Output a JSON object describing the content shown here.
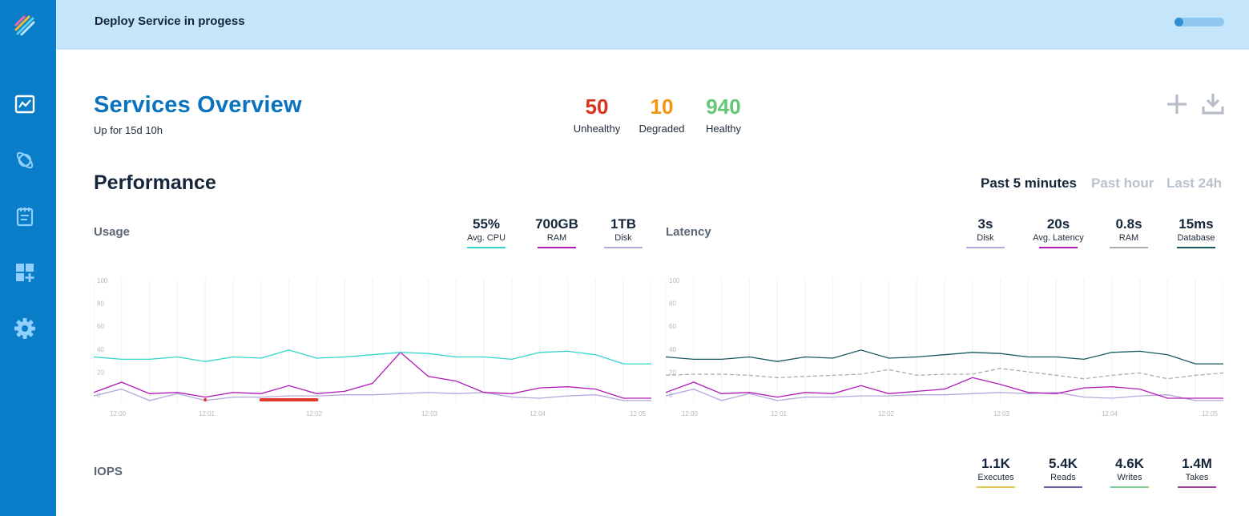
{
  "topbar": {
    "title": "Deploy Service in progess",
    "progress_pct": 0
  },
  "header": {
    "title": "Services Overview",
    "uptime": "Up for 15d 10h"
  },
  "summary": [
    {
      "value": "50",
      "label": "Unhealthy",
      "color": "#d9321f"
    },
    {
      "value": "10",
      "label": "Degraded",
      "color": "#f5950f"
    },
    {
      "value": "940",
      "label": "Healthy",
      "color": "#63c774"
    }
  ],
  "sidebar": {
    "icons": [
      "logo-icon",
      "chart-icon",
      "planet-icon",
      "notepad-icon",
      "add-widget-icon",
      "gear-icon"
    ]
  },
  "performance": {
    "title": "Performance",
    "ranges": [
      {
        "label": "Past 5 minutes",
        "active": true
      },
      {
        "label": "Past hour",
        "active": false
      },
      {
        "label": "Last 24h",
        "active": false
      }
    ]
  },
  "usage": {
    "label": "Usage",
    "metrics": [
      {
        "value": "55%",
        "label": "Avg. CPU",
        "color": "#30d6cb"
      },
      {
        "value": "700GB",
        "label": "RAM",
        "color": "#b21ab8"
      },
      {
        "value": "1TB",
        "label": "Disk",
        "color": "#b5a8dd"
      }
    ]
  },
  "latency": {
    "label": "Latency",
    "metrics": [
      {
        "value": "3s",
        "label": "Disk",
        "color": "#b5a8dd"
      },
      {
        "value": "20s",
        "label": "Avg. Latency",
        "color": "#b21ab8"
      },
      {
        "value": "0.8s",
        "label": "RAM",
        "color": "#a8acb3"
      },
      {
        "value": "15ms",
        "label": "Database",
        "color": "#15595e"
      }
    ]
  },
  "iops": {
    "label": "IOPS",
    "metrics": [
      {
        "value": "1.1K",
        "label": "Executes",
        "color": "#e8c84a"
      },
      {
        "value": "5.4K",
        "label": "Reads",
        "color": "#6e5a9a"
      },
      {
        "value": "4.6K",
        "label": "Writes",
        "color": "#7fd08c"
      },
      {
        "value": "1.4M",
        "label": "Takes",
        "color": "#9c3e96"
      }
    ]
  },
  "chart_data": [
    {
      "type": "line",
      "name": "usage",
      "x": [
        "12:00",
        "12:01",
        "12:02",
        "12:03",
        "12:04",
        "12:05"
      ],
      "yticks": [
        0,
        20,
        40,
        60,
        80,
        100
      ],
      "ylim": [
        0,
        100
      ],
      "series": [
        {
          "name": "Avg. CPU",
          "color": "#30d6cb",
          "values": [
            36,
            34,
            34,
            36,
            32,
            36,
            35,
            42,
            35,
            36,
            38,
            40,
            39,
            36,
            36,
            34,
            40,
            41,
            38,
            30,
            30
          ]
        },
        {
          "name": "RAM",
          "color": "#b21ab8",
          "values": [
            5,
            14,
            4,
            5,
            1,
            5,
            4,
            11,
            4,
            6,
            13,
            40,
            19,
            15,
            5,
            4,
            9,
            10,
            8,
            0,
            0
          ]
        },
        {
          "name": "Disk",
          "color": "#b5a8dd",
          "values": [
            2,
            8,
            -2,
            4,
            -2,
            1,
            1,
            2,
            2,
            3,
            3,
            4,
            5,
            4,
            5,
            1,
            0,
            2,
            3,
            -2,
            -2
          ]
        }
      ],
      "annotations": [
        {
          "type": "marker",
          "x_index": 4,
          "color": "#e03a2a"
        },
        {
          "type": "range-bar",
          "from_index": 6,
          "to_index": 8,
          "color": "#e03a2a"
        }
      ]
    },
    {
      "type": "line",
      "name": "latency",
      "x": [
        "12:00",
        "12:01",
        "12:02",
        "12:03",
        "12:04",
        "12:05"
      ],
      "yticks": [
        0,
        20,
        40,
        60,
        80,
        100
      ],
      "ylim": [
        0,
        100
      ],
      "series": [
        {
          "name": "Database",
          "color": "#15595e",
          "values": [
            36,
            34,
            34,
            36,
            32,
            36,
            35,
            42,
            35,
            36,
            38,
            40,
            39,
            36,
            36,
            34,
            40,
            41,
            38,
            30,
            30
          ]
        },
        {
          "name": "RAM",
          "color": "#a8acb3",
          "dashed": true,
          "values": [
            20,
            21,
            21,
            20,
            18,
            19,
            20,
            21,
            25,
            20,
            21,
            21,
            26,
            23,
            20,
            17,
            20,
            22,
            17,
            20,
            22
          ]
        },
        {
          "name": "Avg. Latency",
          "color": "#b21ab8",
          "values": [
            5,
            14,
            4,
            5,
            1,
            5,
            4,
            11,
            4,
            6,
            8,
            18,
            12,
            5,
            4,
            9,
            10,
            8,
            0,
            0,
            0
          ]
        },
        {
          "name": "Disk",
          "color": "#b5a8dd",
          "values": [
            2,
            8,
            -2,
            4,
            -2,
            1,
            1,
            2,
            2,
            3,
            3,
            4,
            5,
            4,
            5,
            1,
            0,
            2,
            3,
            -2,
            -2
          ]
        }
      ]
    }
  ]
}
